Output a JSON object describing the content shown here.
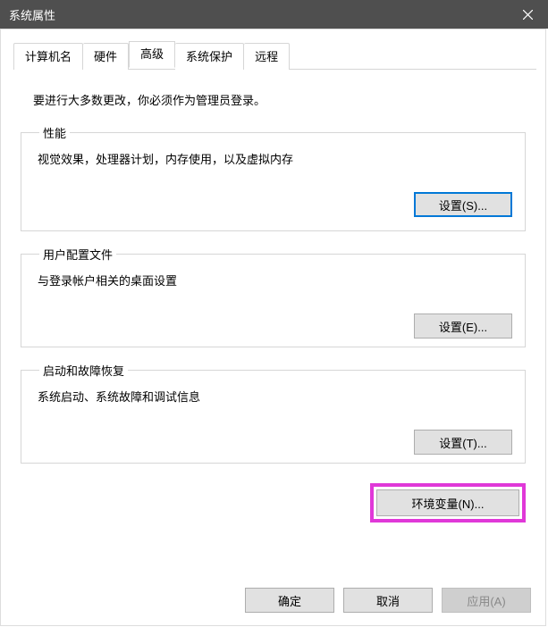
{
  "titlebar": {
    "title": "系统属性"
  },
  "tabs": {
    "computer_name": "计算机名",
    "hardware": "硬件",
    "advanced": "高级",
    "system_protection": "系统保护",
    "remote": "远程"
  },
  "content": {
    "admin_note": "要进行大多数更改，你必须作为管理员登录。",
    "performance": {
      "legend": "性能",
      "desc": "视觉效果，处理器计划，内存使用，以及虚拟内存",
      "button": "设置(S)..."
    },
    "user_profiles": {
      "legend": "用户配置文件",
      "desc": "与登录帐户相关的桌面设置",
      "button": "设置(E)..."
    },
    "startup": {
      "legend": "启动和故障恢复",
      "desc": "系统启动、系统故障和调试信息",
      "button": "设置(T)..."
    },
    "env_button": "环境变量(N)..."
  },
  "footer": {
    "ok": "确定",
    "cancel": "取消",
    "apply": "应用(A)"
  }
}
